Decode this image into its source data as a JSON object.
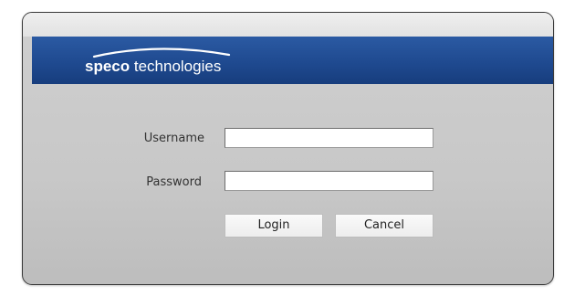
{
  "brand": {
    "bold": "speco",
    "rest": " technologies",
    "banner_color": "#1f4a90"
  },
  "form": {
    "username_label": "Username",
    "username_value": "",
    "password_label": "Password",
    "password_value": "",
    "login_label": "Login",
    "cancel_label": "Cancel"
  }
}
